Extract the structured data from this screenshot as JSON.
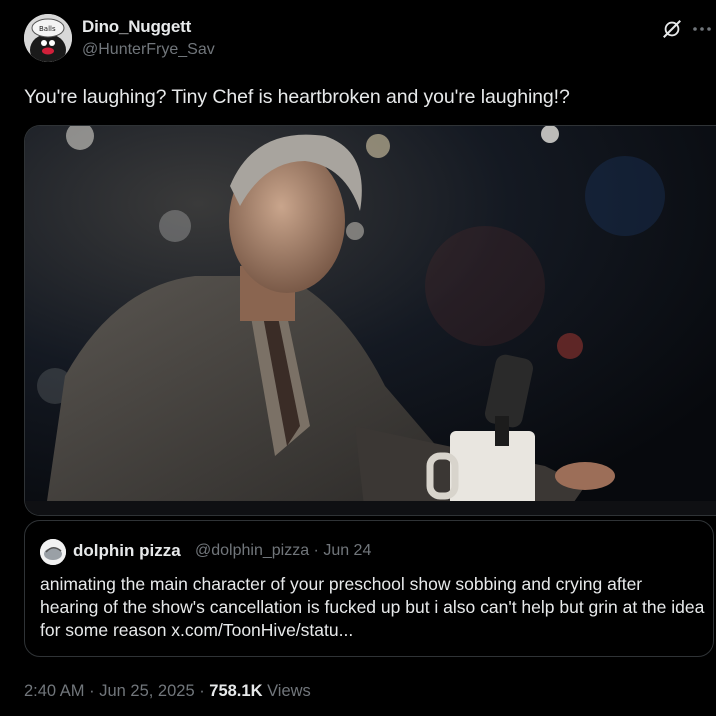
{
  "author": {
    "display_name": "Dino_Nuggett",
    "handle": "@HunterFrye_Sav",
    "avatar_icon": "penguin-avatar-icon"
  },
  "header_icons": [
    "grok-icon",
    "more-icon"
  ],
  "tweet": {
    "text": "You're laughing? Tiny Chef is heartbroken and you're laughing!?"
  },
  "media": {
    "type": "image",
    "subject": "man-at-bar-photo"
  },
  "quote": {
    "display_name": "dolphin pizza",
    "meta": "@dolphin_pizza · Jun 24",
    "text": "animating the main character of your preschool show sobbing and crying after hearing of the show's cancellation is fucked up but i also can't help but grin at the idea for some reason x.com/ToonHive/statu..."
  },
  "footer": {
    "timestamp": "2:40 AM · Jun 25, 2025 · ",
    "views_count": "758.1K",
    "views_label": " Views"
  },
  "colors": {
    "background": "#000000",
    "text_primary": "#e7e9ea",
    "text_secondary": "#71767b",
    "border": "#2f3336"
  }
}
